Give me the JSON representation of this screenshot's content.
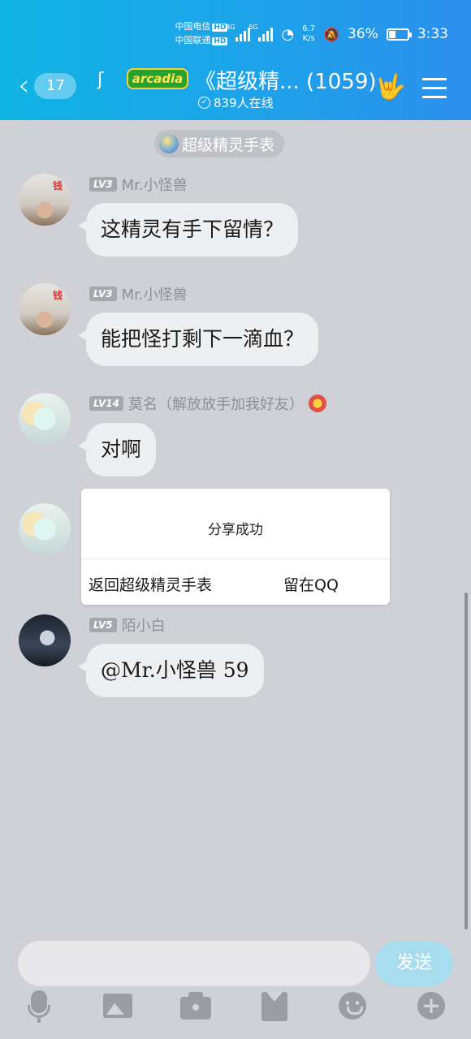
{
  "status_bar": {
    "carrier1": "中国电信",
    "carrier2": "中国联通",
    "hd": "HD",
    "net1": "4G",
    "net2": "5G",
    "speed_value": "6.7",
    "speed_unit": "K/s",
    "battery": "36%",
    "time": "3:33"
  },
  "header": {
    "back_badge": "17",
    "logo_text": "arcadia",
    "title": "《超级精...  (1059)",
    "online": "839人在线"
  },
  "group_pill": "超级精灵手表",
  "messages": [
    {
      "level": "LV3",
      "name": "Mr.小怪兽",
      "text": "这精灵有手下留情？",
      "avatar_mark": "钱"
    },
    {
      "level": "LV3",
      "name": "Mr.小怪兽",
      "text": "能把怪打剩下一滴血？",
      "avatar_mark": "钱"
    },
    {
      "level": "LV14",
      "name": "莫名（解放放手加我好友）",
      "text": "对啊"
    },
    {
      "level": "LV5",
      "name": "陌小白",
      "text": "@Mr.小怪兽 59"
    }
  ],
  "dialog": {
    "title": "分享成功",
    "return_label": "返回超级精灵手表",
    "stay_label": "留在QQ"
  },
  "input": {
    "placeholder": "",
    "send_label": "发送"
  },
  "colors": {
    "header_start": "#0fb4e4",
    "header_end": "#2b8fec",
    "send_button": "#a8dcef"
  }
}
